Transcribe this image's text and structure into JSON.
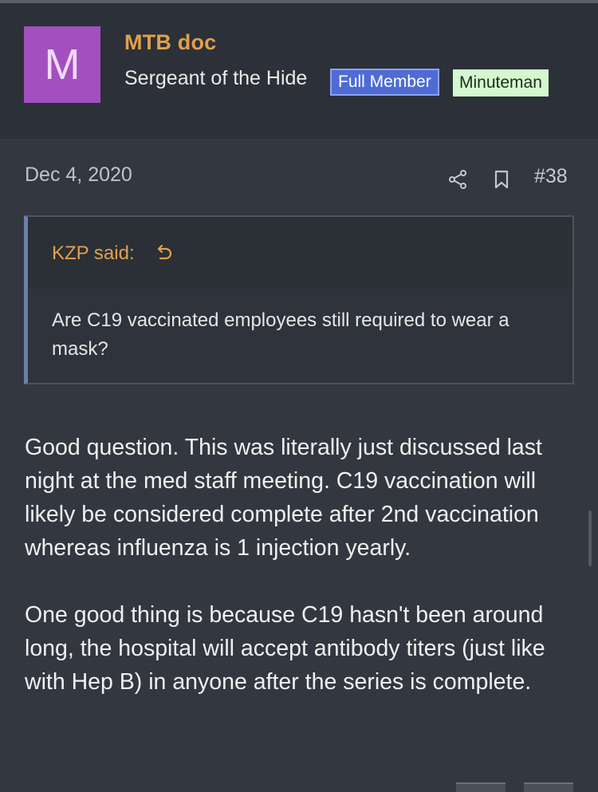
{
  "user": {
    "avatar_letter": "M",
    "username": "MTB doc",
    "title": "Sergeant of the Hide",
    "badges": [
      "Full Member",
      "Minuteman"
    ]
  },
  "post": {
    "date": "Dec 4, 2020",
    "number": "#38",
    "quote": {
      "author": "KZP said:",
      "text": "Are C19 vaccinated employees still required to wear a mask?"
    },
    "paragraphs": [
      "Good question. This was literally just discussed last night at the med staff meeting. C19 vaccination will likely be considered complete after 2nd vaccination whereas influenza is 1 injection yearly.",
      "One good thing is because C19 hasn't been around long, the hospital will accept antibody titers (just like with Hep B) in anyone after the series is complete."
    ]
  },
  "icons": {
    "share": "share-icon",
    "bookmark": "bookmark-icon",
    "quote_jump": "jump-to-quote-icon"
  },
  "colors": {
    "background": "#33373f",
    "header_background": "#2c3038",
    "username": "#e1a04b",
    "avatar": "#a34fc0",
    "badge_full_member": "#4f6bd6",
    "badge_minuteman": "#d4f7cf"
  }
}
